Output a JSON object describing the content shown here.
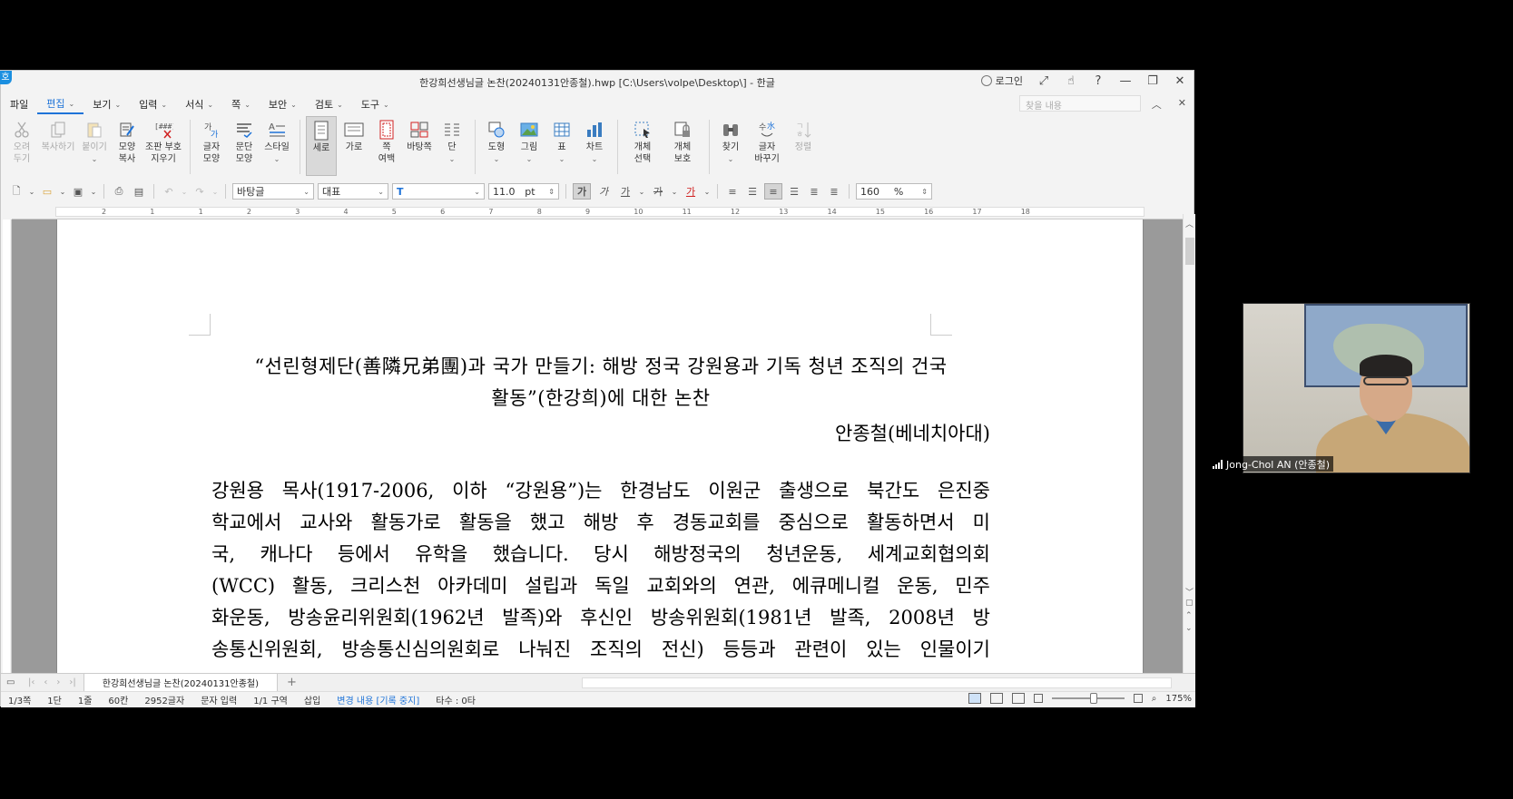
{
  "window": {
    "app_badge": "호",
    "title": "한강희선생님글 논찬(20240131안종철).hwp [C:\\Users\\volpe\\Desktop\\] - 한글",
    "login_label": "로그인",
    "controls": {
      "expand": "⤢",
      "hand": "☝",
      "help": "?",
      "minimize": "—",
      "restore": "❐",
      "close": "✕"
    }
  },
  "menu": {
    "items": [
      {
        "label": "파일",
        "active": false,
        "caret": false
      },
      {
        "label": "편집",
        "active": true,
        "caret": true
      },
      {
        "label": "보기",
        "active": false,
        "caret": true
      },
      {
        "label": "입력",
        "active": false,
        "caret": true
      },
      {
        "label": "서식",
        "active": false,
        "caret": true
      },
      {
        "label": "쪽",
        "active": false,
        "caret": true
      },
      {
        "label": "보안",
        "active": false,
        "caret": true
      },
      {
        "label": "검토",
        "active": false,
        "caret": true
      },
      {
        "label": "도구",
        "active": false,
        "caret": true
      }
    ],
    "search_placeholder": "찾을 내용"
  },
  "ribbon": {
    "cut": [
      "오려",
      "두기"
    ],
    "copy": "복사하기",
    "paste": "붙이기",
    "shape_copy": [
      "모양",
      "복사"
    ],
    "remove_code": [
      "조판 부호",
      "지우기"
    ],
    "char_shape": [
      "글자",
      "모양"
    ],
    "para_shape": [
      "문단",
      "모양"
    ],
    "style": "스타일",
    "vertical": "세로",
    "horizontal": "가로",
    "page_margin": [
      "쪽",
      "여백"
    ],
    "background_page": "바탕쪽",
    "columns": "단",
    "shapes": "도형",
    "picture": "그림",
    "table": "표",
    "chart": "차트",
    "object_select": [
      "개체",
      "선택"
    ],
    "object_protect": [
      "개체",
      "보호"
    ],
    "find": "찾기",
    "char_replace": [
      "글자",
      "바꾸기"
    ],
    "sort": "정렬"
  },
  "toolbar": {
    "style_combo": "바탕글",
    "lang_combo": "대표",
    "font_combo": "",
    "font_size": "11.0",
    "unit": "pt",
    "line_spacing": "160",
    "percent": "%",
    "bold": "가",
    "italic": "가",
    "underline": "가",
    "strike": "가",
    "color": "가"
  },
  "ruler": {
    "numbers": [
      "2",
      "1",
      "1",
      "2",
      "3",
      "4",
      "5",
      "6",
      "7",
      "8",
      "9",
      "10",
      "11",
      "12",
      "13",
      "14",
      "15",
      "16",
      "17",
      "18"
    ]
  },
  "document": {
    "title_line1": "“선린형제단(善隣兄弟團)과 국가 만들기: 해방 정국 강원용과 기독 청년 조직의 건국",
    "title_line2": "활동”(한강희)에 대한 논찬",
    "author": "안종철(베네치아대)",
    "body_lines": [
      "강원용 목사(1917-2006, 이하 “강원용”)는 한경남도 이원군 출생으로 북간도 은진중",
      "학교에서 교사와 활동가로 활동을 했고 해방 후 경동교회를 중심으로 활동하면서 미",
      "국, 캐나다 등에서 유학을 했습니다. 당시 해방정국의 청년운동, 세계교회협의회",
      "(WCC) 활동, 크리스천 아카데미 설립과 독일 교회와의 연관, 에큐메니컬 운동, 민주",
      "화운동, 방송윤리위원회(1962년 발족)와 후신인 방송위원회(1981년 발족, 2008년 방",
      "송통신위원회, 방송통신심의원회로 나눠진 조직의 전신) 등등과 관련이 있는 인물이기"
    ]
  },
  "tabs": {
    "doc_tab": "한강희선생님글 논찬(20240131안종철)",
    "add": "+"
  },
  "status": {
    "page": "1/3쪽",
    "column": "1단",
    "line": "1줄",
    "col": "60칸",
    "chars": "2952글자",
    "input_mode": "문자 입력",
    "section": "1/1 구역",
    "insert": "삽입",
    "track": "변경 내용 [기록 중지]",
    "strokes": "타수 : 0타",
    "zoom": "175%"
  },
  "video": {
    "participant": "Jong-Chol AN (안종철)"
  }
}
